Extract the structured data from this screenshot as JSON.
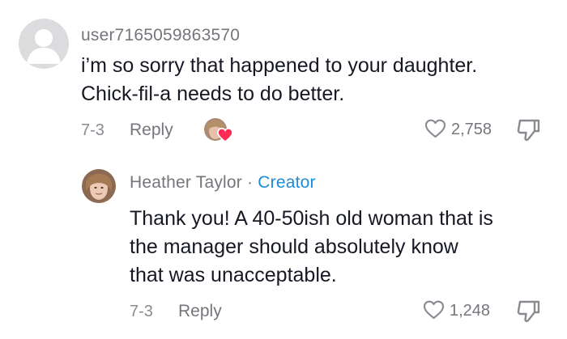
{
  "comment": {
    "username": "user7165059863570",
    "text_line1": "i’m so sorry that happened to your daughter.",
    "text_line2": "Chick-fil-a needs to do better.",
    "date": "7-3",
    "reply_label": "Reply",
    "like_count": "2,758"
  },
  "reply": {
    "author": "Heather Taylor",
    "separator": "·",
    "badge": "Creator",
    "text_line1": "Thank you! A 40-50ish old woman that is",
    "text_line2": "the manager should absolutely know",
    "text_line3": "that was unacceptable.",
    "date": "7-3",
    "reply_label": "Reply",
    "like_count": "1,248"
  },
  "colors": {
    "text": "#161823",
    "secondary": "#75767c",
    "creator_badge": "#1d8bd8",
    "heart_badge": "#fe2c55"
  }
}
